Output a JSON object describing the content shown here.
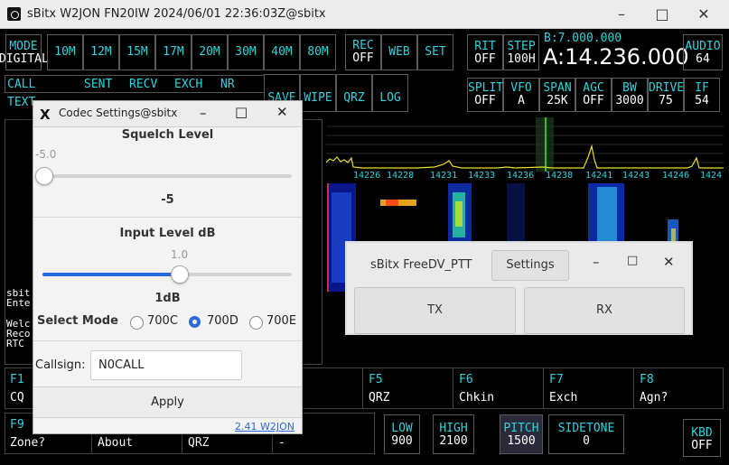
{
  "window": {
    "title": "sBitx W2JON FN20IW 2024/06/01 22:36:03Z@sbitx"
  },
  "top_row": {
    "mode": {
      "label": "MODE",
      "value": "DIGITAL"
    },
    "bands": [
      "10M",
      "12M",
      "15M",
      "17M",
      "20M",
      "30M",
      "40M",
      "80M"
    ],
    "rec": {
      "label": "REC",
      "value": "OFF"
    },
    "web": "WEB",
    "set": "SET",
    "rit": {
      "label": "RIT",
      "value": "OFF"
    },
    "step": {
      "label": "STEP",
      "value": "100H"
    },
    "vfo_b": "B:7.000.000",
    "vfo_a": "A:14.236.000",
    "audio": {
      "label": "AUDIO",
      "value": "64"
    }
  },
  "second_row": {
    "call": "CALL",
    "sent": "SENT",
    "recv": "RECV",
    "exch": "EXCH",
    "nr": "NR",
    "text": "TEXT",
    "save": "SAVE",
    "wipe": "WIPE",
    "qrz": "QRZ",
    "log": "LOG",
    "split": {
      "label": "SPLIT",
      "value": "OFF"
    },
    "vfo": {
      "label": "VFO",
      "value": "A"
    },
    "span": {
      "label": "SPAN",
      "value": "25K"
    },
    "agc": {
      "label": "AGC",
      "value": "OFF"
    },
    "bw": {
      "label": "BW",
      "value": "3000"
    },
    "drive": {
      "label": "DRIVE",
      "value": "75"
    },
    "if": {
      "label": "IF",
      "value": "54"
    }
  },
  "spectrum": {
    "freq_labels": [
      "14226",
      "14228",
      "14231",
      "14233",
      "14236",
      "14238",
      "14241",
      "14243",
      "14246",
      "1424"
    ]
  },
  "log_text": [
    "sbit",
    "Ente",
    "",
    "Welc",
    "Reco",
    "RTC"
  ],
  "fkeys": [
    {
      "key": "F1",
      "label": "CQ"
    },
    {
      "key": "F5",
      "label": "QRZ"
    },
    {
      "key": "F6",
      "label": "Chkin"
    },
    {
      "key": "F7",
      "label": "Exch"
    },
    {
      "key": "F8",
      "label": "Agn?"
    },
    {
      "key": "F9",
      "label": "Zone?"
    }
  ],
  "bottom_row": {
    "about": "About",
    "qrz": "QRZ",
    "dash": "-",
    "low": {
      "label": "LOW",
      "value": "900"
    },
    "high": {
      "label": "HIGH",
      "value": "2100"
    },
    "pitch": {
      "label": "PITCH",
      "value": "1500"
    },
    "sidetone": {
      "label": "SIDETONE",
      "value": "0"
    },
    "kbd": {
      "label": "KBD",
      "value": "OFF"
    }
  },
  "codec": {
    "title": "Codec Settings@sbitx",
    "squelch": {
      "heading": "Squelch Level",
      "tick": "-5.0",
      "value_text": "-5",
      "level": -5.0
    },
    "input": {
      "heading": "Input Level dB",
      "tick": "1.0",
      "value_text": "1dB",
      "level": 1.0
    },
    "mode": {
      "heading": "Select Mode",
      "options": [
        "700C",
        "700D",
        "700E"
      ],
      "selected": "700D"
    },
    "callsign": {
      "label": "Callsign:",
      "value": "N0CALL"
    },
    "apply": "Apply",
    "version": "2.41 W2JON"
  },
  "freedv": {
    "title": "sBitx FreeDV_PTT",
    "settings": "Settings",
    "tx": "TX",
    "rx": "RX"
  },
  "colors": {
    "accent": "#2fd3df",
    "spectrum": "#e5e02a",
    "background": "#000000"
  }
}
